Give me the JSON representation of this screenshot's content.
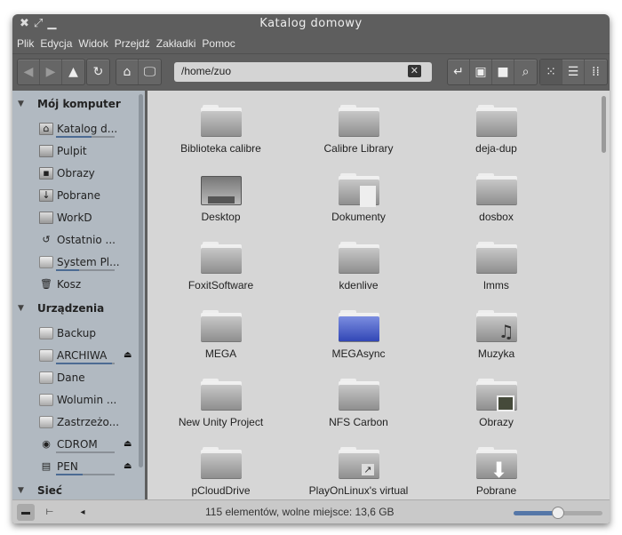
{
  "window": {
    "title": "Katalog domowy"
  },
  "menu": [
    "Plik",
    "Edycja",
    "Widok",
    "Przejdź",
    "Zakładki",
    "Pomoc"
  ],
  "toolbar": {
    "path": "/home/zuo"
  },
  "sidebar": {
    "sections": [
      {
        "title": "Mój komputer",
        "items": [
          {
            "label": "Katalog d...",
            "icon": "home-folder-icon",
            "usage": 0.6
          },
          {
            "label": "Pulpit",
            "icon": "desktop-icon"
          },
          {
            "label": "Obrazy",
            "icon": "pictures-folder-icon"
          },
          {
            "label": "Pobrane",
            "icon": "downloads-folder-icon"
          },
          {
            "label": "WorkD",
            "icon": "folder-icon"
          },
          {
            "label": "Ostatnio ...",
            "icon": "recent-icon"
          },
          {
            "label": "System Pl...",
            "icon": "drive-icon",
            "usage": 0.4
          },
          {
            "label": "Kosz",
            "icon": "trash-icon"
          }
        ]
      },
      {
        "title": "Urządzenia",
        "items": [
          {
            "label": "Backup",
            "icon": "drive-icon"
          },
          {
            "label": "ARCHIWA",
            "icon": "drive-icon",
            "usage": 0.95,
            "eject": true
          },
          {
            "label": "Dane",
            "icon": "drive-icon"
          },
          {
            "label": "Wolumin ...",
            "icon": "drive-icon"
          },
          {
            "label": "Zastrzeżo...",
            "icon": "drive-icon"
          },
          {
            "label": "CDROM",
            "icon": "cdrom-icon",
            "usage": 0.0,
            "eject": true
          },
          {
            "label": "PEN",
            "icon": "usb-drive-icon",
            "usage": 0.45,
            "eject": true
          }
        ]
      },
      {
        "title": "Sieć",
        "items": []
      }
    ]
  },
  "files": [
    {
      "name": "Biblioteka calibre"
    },
    {
      "name": "Calibre Library"
    },
    {
      "name": "deja-dup"
    },
    {
      "name": "Desktop",
      "type": "desktop"
    },
    {
      "name": "Dokumenty",
      "type": "documents"
    },
    {
      "name": "dosbox"
    },
    {
      "name": "FoxitSoftware"
    },
    {
      "name": "kdenlive"
    },
    {
      "name": "lmms"
    },
    {
      "name": "MEGA"
    },
    {
      "name": "MEGAsync",
      "type": "blue"
    },
    {
      "name": "Muzyka",
      "type": "music"
    },
    {
      "name": "New Unity Project"
    },
    {
      "name": "NFS Carbon"
    },
    {
      "name": "Obrazy",
      "type": "pictures"
    },
    {
      "name": "pCloudDrive"
    },
    {
      "name": "PlayOnLinux's virtual",
      "type": "link"
    },
    {
      "name": "Pobrane",
      "type": "downloads"
    }
  ],
  "status": {
    "text": "115 elementów, wolne miejsce: 13,6 GB",
    "zoom": 0.5
  },
  "colors": {
    "accent": "#4c6b93",
    "sidebar": "#b1b9c1",
    "content": "#d6d6d6",
    "chrome": "#5e5e5e"
  }
}
